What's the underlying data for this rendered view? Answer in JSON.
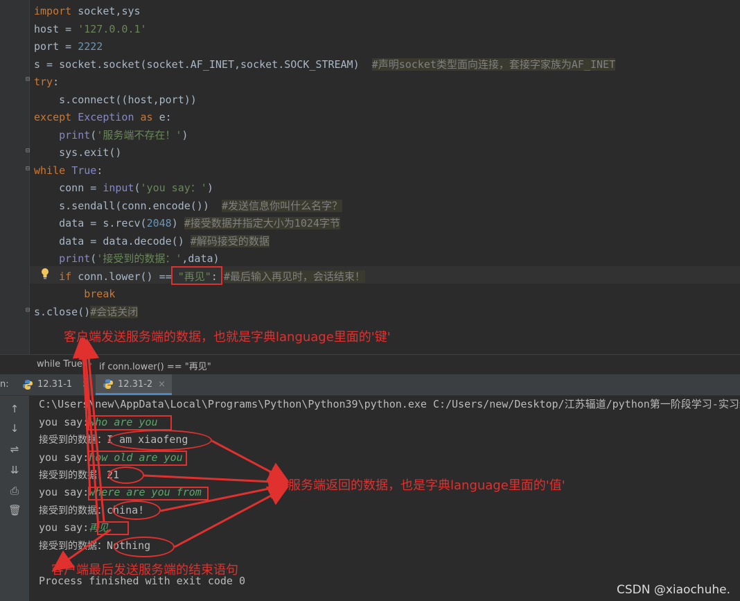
{
  "code": {
    "lines": [
      {
        "id": "l1",
        "parts": [
          [
            "kw",
            "import"
          ],
          [
            "txt",
            " socket"
          ],
          [
            "txt",
            ","
          ],
          [
            "txt",
            "sys"
          ]
        ]
      },
      {
        "id": "l2",
        "parts": [
          [
            "txt",
            "host = "
          ],
          [
            "str",
            "'127.0.0.1'"
          ]
        ]
      },
      {
        "id": "l3",
        "parts": [
          [
            "txt",
            "port = "
          ],
          [
            "num",
            "2222"
          ]
        ]
      },
      {
        "id": "l4",
        "parts": [
          [
            "txt",
            "s = socket.socket(socket.AF_INET"
          ],
          [
            "txt",
            ","
          ],
          [
            "txt",
            "socket.SOCK_STREAM)  "
          ],
          [
            "cmt",
            "#声明socket类型面向连接，套接字家族为AF_INET"
          ]
        ]
      },
      {
        "id": "l5",
        "parts": [
          [
            "kw",
            "try"
          ],
          [
            "txt",
            ":"
          ]
        ]
      },
      {
        "id": "l6",
        "parts": [
          [
            "txt",
            "    s.connect((host"
          ],
          [
            "txt",
            ","
          ],
          [
            "txt",
            "port))"
          ]
        ]
      },
      {
        "id": "l7",
        "parts": [
          [
            "kw",
            "except "
          ],
          [
            "cls",
            "Exception"
          ],
          [
            "kw",
            " as "
          ],
          [
            "txt",
            "e:"
          ]
        ]
      },
      {
        "id": "l8",
        "parts": [
          [
            "fn",
            "    print"
          ],
          [
            "txt",
            "("
          ],
          [
            "str",
            "'服务端不存在！'"
          ],
          [
            "txt",
            ")"
          ]
        ]
      },
      {
        "id": "l9",
        "parts": [
          [
            "txt",
            "    sys.exit()"
          ]
        ]
      },
      {
        "id": "l10",
        "parts": [
          [
            "kw",
            "while "
          ],
          [
            "cls",
            "True"
          ],
          [
            "txt",
            ":"
          ]
        ]
      },
      {
        "id": "l11",
        "parts": [
          [
            "txt",
            "    conn = "
          ],
          [
            "fn",
            "input"
          ],
          [
            "txt",
            "("
          ],
          [
            "str",
            "'you say：'"
          ],
          [
            "txt",
            ")"
          ]
        ]
      },
      {
        "id": "l12",
        "parts": [
          [
            "txt",
            "    s.sendall(conn.encode())  "
          ],
          [
            "cmt",
            "#发送信息你叫什么名字？"
          ]
        ]
      },
      {
        "id": "l13",
        "parts": [
          [
            "txt",
            "    data = s.recv("
          ],
          [
            "num",
            "2048"
          ],
          [
            "txt",
            ") "
          ],
          [
            "cmt",
            "#接受数据并指定大小为1024字节"
          ]
        ]
      },
      {
        "id": "l14",
        "parts": [
          [
            "txt",
            "    data = data.decode() "
          ],
          [
            "cmt",
            "#解码接受的数据"
          ]
        ]
      },
      {
        "id": "l15",
        "parts": [
          [
            "fn",
            "    print"
          ],
          [
            "txt",
            "("
          ],
          [
            "str",
            "'接受到的数据：'"
          ],
          [
            "txt",
            ",data)"
          ]
        ]
      },
      {
        "id": "l16",
        "parts": [
          [
            "kw",
            "    if "
          ],
          [
            "txt",
            "conn.lower() == "
          ],
          [
            "str",
            "\"再见\""
          ],
          [
            "txt",
            ": "
          ],
          [
            "cmt",
            "#最后输入再见时，会话结束！"
          ]
        ]
      },
      {
        "id": "l17",
        "parts": [
          [
            "kw",
            "        break"
          ]
        ]
      },
      {
        "id": "l18",
        "parts": [
          [
            "txt",
            "s.close()"
          ],
          [
            "cmt",
            "#会话关闭"
          ]
        ]
      }
    ]
  },
  "breadcrumb": {
    "first": "while True",
    "sep": "›",
    "second": "if conn.lower() == \"再见\""
  },
  "tabs": {
    "run_prefix": "n:",
    "tab1": "12.31-1",
    "tab2": "12.31-2",
    "close": "×"
  },
  "console": {
    "command": "C:\\Users\\new\\AppData\\Local\\Programs\\Python\\Python39\\python.exe C:/Users/new/Desktop/江苏辐道/python第一阶段学习-实习练",
    "prompt": "you say:",
    "recv_label": "接受到的数据：",
    "inputs": [
      "who are you",
      "how old are you",
      "where are you from",
      "再见"
    ],
    "replies": [
      "I am xiaofeng",
      "21",
      "china!",
      "Nothing"
    ],
    "exit": "Process finished with exit code 0"
  },
  "notes": {
    "top": "客户端发送服务端的数据，也就是字典language里面的'键'",
    "right": "服务端返回的数据，也是字典language里面的'值'",
    "bottom": "客户端最后发送服务端的结束语句"
  },
  "watermark": "CSDN @xiaochuhe.",
  "colors": {
    "annotation": "#e0312f",
    "keyword": "#cc7832",
    "string": "#6a8759",
    "comment": "#808080"
  }
}
